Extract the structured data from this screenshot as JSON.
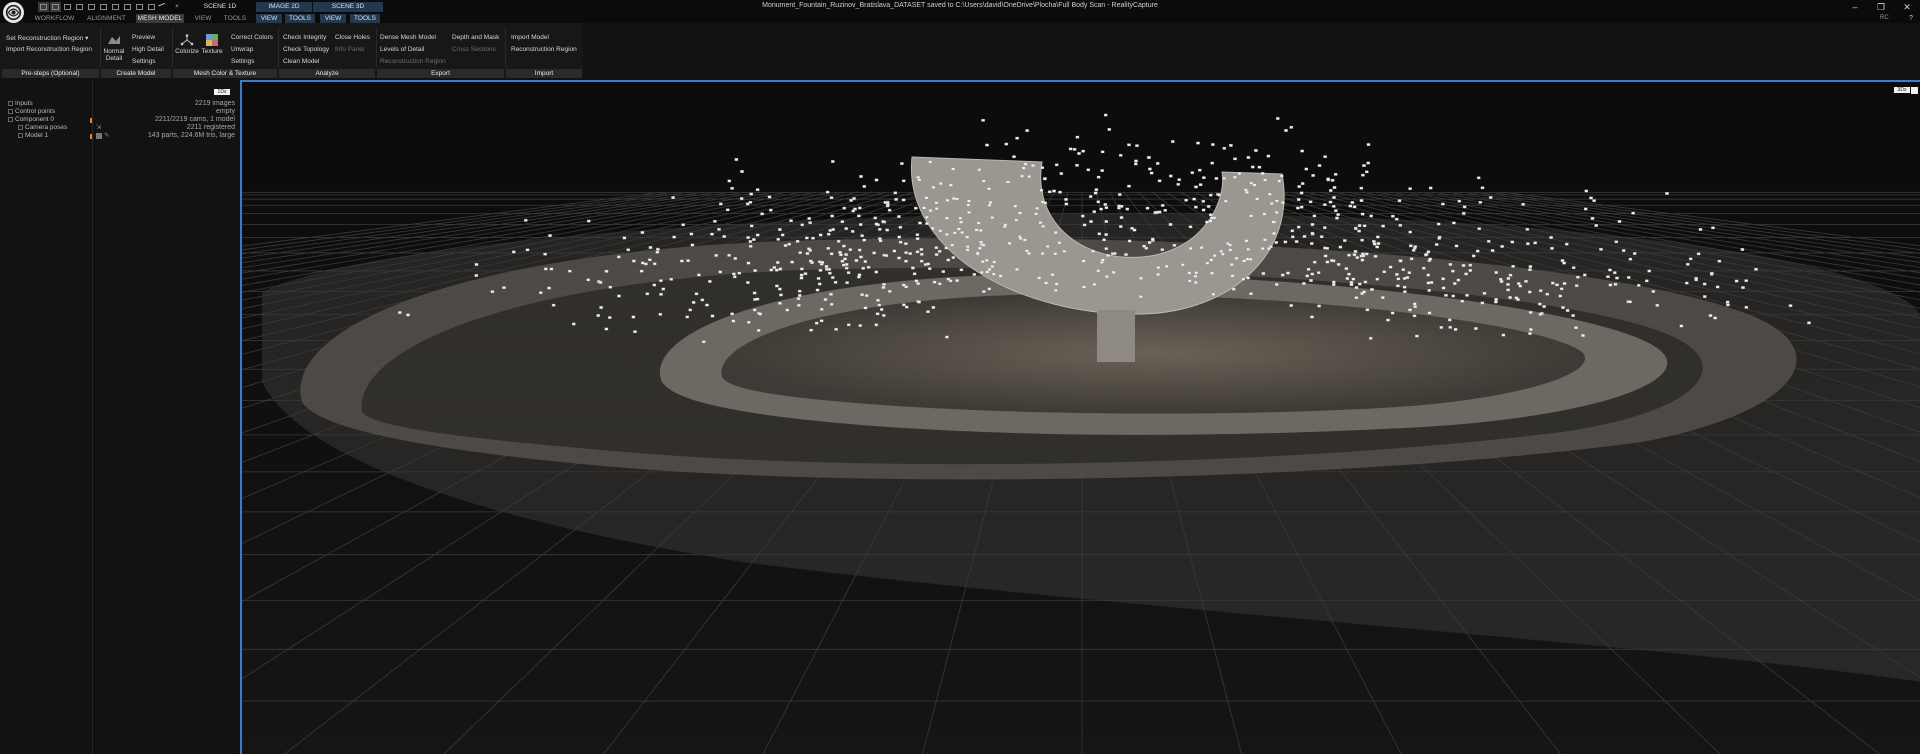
{
  "window": {
    "title": "Monument_Fountain_Ruzinov_Bratislava_DATASET saved to C:\\Users\\david\\OneDrive\\Plocha\\Full Body Scan - RealityCapture",
    "minimize": "–",
    "maximize": "❐",
    "close": "✕"
  },
  "layout_tabs": {
    "close_glyph": "×",
    "scene1d": "SCENE 1D",
    "image2d": "IMAGE 2D",
    "scene3d": "SCENE 3D"
  },
  "main_tabs": [
    "WORKFLOW",
    "ALIGNMENT",
    "MESH MODEL",
    "VIEW",
    "TOOLS"
  ],
  "active_tab": "MESH MODEL",
  "view_tabs": [
    "VIEW",
    "TOOLS",
    "VIEW",
    "TOOLS"
  ],
  "rc_badge": "RC",
  "ribbon": {
    "prestep": {
      "set_region": "Set Reconstruction Region",
      "set_region_arrow": "▾",
      "import_region": "Import Reconstruction Region",
      "label": "Pre-steps (Optional)"
    },
    "create": {
      "normal_detail": "Normal Detail",
      "preview": "Preview",
      "high_detail": "High Detail",
      "settings": "Settings",
      "label": "Create Model"
    },
    "color_texture": {
      "colorize": "Colorize",
      "texture": "Texture",
      "correct_colors": "Correct Colors",
      "unwrap": "Unwrap",
      "settings": "Settings",
      "label": "Mesh Color & Texture"
    },
    "analyze": {
      "check_integrity": "Check Integrity",
      "close_holes": "Close Holes",
      "check_topology": "Check Topology",
      "info_panel": "Info Panel",
      "clean_model": "Clean Model",
      "label": "Analyze"
    },
    "export": {
      "dense_mesh": "Dense Mesh Model",
      "depth_mask": "Depth and Mask",
      "levels_detail": "Levels of Detail",
      "cross_sections": "Cross Sections",
      "recon_region": "Reconstruction Region",
      "label": "Export"
    },
    "import": {
      "import_model": "Import Model",
      "recon_region": "Reconstruction Region",
      "label": "Import"
    }
  },
  "panel_1ds": {
    "badge": "1Ds",
    "tree": [
      {
        "label": "Inputs",
        "value": "2219 images"
      },
      {
        "label": "Control points",
        "value": "empty"
      },
      {
        "label": "Component 0",
        "value": "2211/2219 cams, 1 model"
      },
      {
        "label": "Camera poses",
        "value": "2211 registered"
      },
      {
        "label": "Model 1",
        "value": "143 parts, 224.6M tris, large"
      }
    ]
  },
  "viewport": {
    "badge": "3Ds"
  },
  "colors": {
    "accent": "#3a7cc8",
    "tab_active": "#3b3b3b",
    "ribbon_bg": "#171717",
    "viewport_bg": "#0c0c0c"
  }
}
